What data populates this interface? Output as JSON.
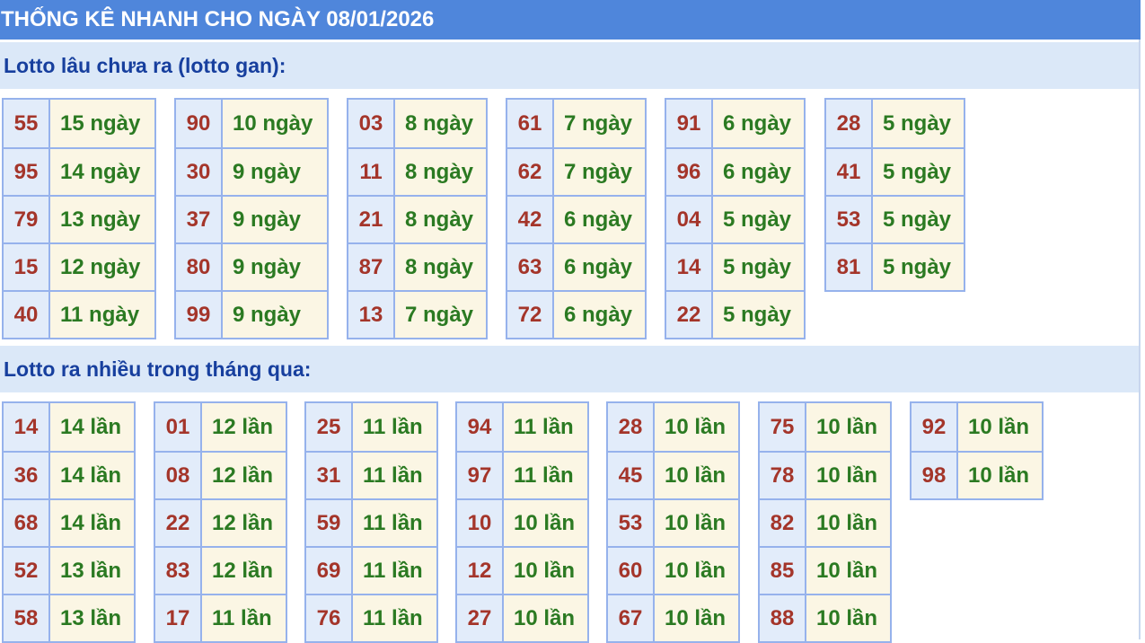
{
  "page": {
    "title": "THỐNG KÊ NHANH CHO NGÀY 08/01/2026"
  },
  "gan": {
    "heading": "Lotto lâu chưa ra (lotto gan):",
    "groups": [
      [
        {
          "num": "55",
          "val": "15 ngày"
        },
        {
          "num": "95",
          "val": "14 ngày"
        },
        {
          "num": "79",
          "val": "13 ngày"
        },
        {
          "num": "15",
          "val": "12 ngày"
        },
        {
          "num": "40",
          "val": "11 ngày"
        }
      ],
      [
        {
          "num": "90",
          "val": "10 ngày"
        },
        {
          "num": "30",
          "val": "9 ngày"
        },
        {
          "num": "37",
          "val": "9 ngày"
        },
        {
          "num": "80",
          "val": "9 ngày"
        },
        {
          "num": "99",
          "val": "9 ngày"
        }
      ],
      [
        {
          "num": "03",
          "val": "8 ngày"
        },
        {
          "num": "11",
          "val": "8 ngày"
        },
        {
          "num": "21",
          "val": "8 ngày"
        },
        {
          "num": "87",
          "val": "8 ngày"
        },
        {
          "num": "13",
          "val": "7 ngày"
        }
      ],
      [
        {
          "num": "61",
          "val": "7 ngày"
        },
        {
          "num": "62",
          "val": "7 ngày"
        },
        {
          "num": "42",
          "val": "6 ngày"
        },
        {
          "num": "63",
          "val": "6 ngày"
        },
        {
          "num": "72",
          "val": "6 ngày"
        }
      ],
      [
        {
          "num": "91",
          "val": "6 ngày"
        },
        {
          "num": "96",
          "val": "6 ngày"
        },
        {
          "num": "04",
          "val": "5 ngày"
        },
        {
          "num": "14",
          "val": "5 ngày"
        },
        {
          "num": "22",
          "val": "5 ngày"
        }
      ],
      [
        {
          "num": "28",
          "val": "5 ngày"
        },
        {
          "num": "41",
          "val": "5 ngày"
        },
        {
          "num": "53",
          "val": "5 ngày"
        },
        {
          "num": "81",
          "val": "5 ngày"
        }
      ]
    ]
  },
  "frequent": {
    "heading": "Lotto ra nhiều trong tháng qua:",
    "groups": [
      [
        {
          "num": "14",
          "val": "14 lần"
        },
        {
          "num": "36",
          "val": "14 lần"
        },
        {
          "num": "68",
          "val": "14 lần"
        },
        {
          "num": "52",
          "val": "13 lần"
        },
        {
          "num": "58",
          "val": "13 lần"
        }
      ],
      [
        {
          "num": "01",
          "val": "12 lần"
        },
        {
          "num": "08",
          "val": "12 lần"
        },
        {
          "num": "22",
          "val": "12 lần"
        },
        {
          "num": "83",
          "val": "12 lần"
        },
        {
          "num": "17",
          "val": "11 lần"
        }
      ],
      [
        {
          "num": "25",
          "val": "11 lần"
        },
        {
          "num": "31",
          "val": "11 lần"
        },
        {
          "num": "59",
          "val": "11 lần"
        },
        {
          "num": "69",
          "val": "11 lần"
        },
        {
          "num": "76",
          "val": "11 lần"
        }
      ],
      [
        {
          "num": "94",
          "val": "11 lần"
        },
        {
          "num": "97",
          "val": "11 lần"
        },
        {
          "num": "10",
          "val": "10 lần"
        },
        {
          "num": "12",
          "val": "10 lần"
        },
        {
          "num": "27",
          "val": "10 lần"
        }
      ],
      [
        {
          "num": "28",
          "val": "10 lần"
        },
        {
          "num": "45",
          "val": "10 lần"
        },
        {
          "num": "53",
          "val": "10 lần"
        },
        {
          "num": "60",
          "val": "10 lần"
        },
        {
          "num": "67",
          "val": "10 lần"
        }
      ],
      [
        {
          "num": "75",
          "val": "10 lần"
        },
        {
          "num": "78",
          "val": "10 lần"
        },
        {
          "num": "82",
          "val": "10 lần"
        },
        {
          "num": "85",
          "val": "10 lần"
        },
        {
          "num": "88",
          "val": "10 lần"
        }
      ],
      [
        {
          "num": "92",
          "val": "10 lần"
        },
        {
          "num": "98",
          "val": "10 lần"
        }
      ]
    ]
  },
  "colors": {
    "title_bar": "#4f86db",
    "section_bg": "#dbe8f8",
    "heading_text": "#173f9e",
    "number_text": "#a4352a",
    "value_text": "#2b7a22",
    "number_cell": "#e2ecfa",
    "value_cell": "#fbf6e4",
    "cell_border": "#96b2ec"
  }
}
